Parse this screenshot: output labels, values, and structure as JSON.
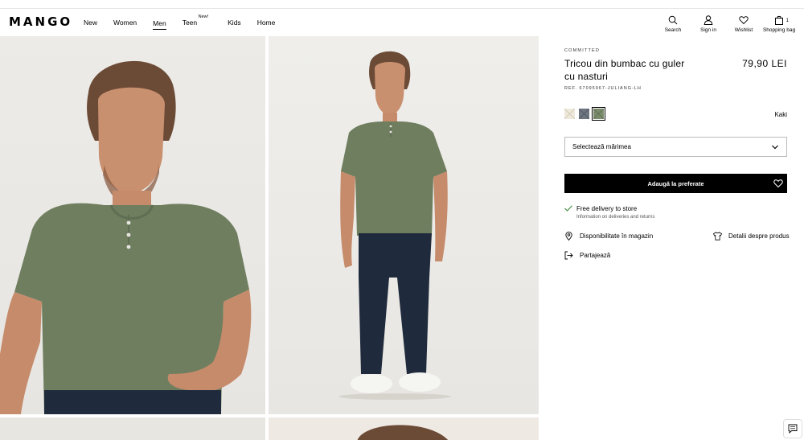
{
  "header": {
    "logo": "MANGO",
    "nav": [
      {
        "label": "New"
      },
      {
        "label": "Women"
      },
      {
        "label": "Men"
      },
      {
        "label": "Teen",
        "badge": "New!"
      },
      {
        "label": "Kids"
      },
      {
        "label": "Home"
      }
    ],
    "tools": {
      "search": "Search",
      "signin": "Sign in",
      "wishlist": "Wishlist",
      "bag": "Shopping bag",
      "bag_count": "1"
    }
  },
  "product": {
    "collection": "COMMITTED",
    "title": "Tricou din bumbac cu guler cu nasturi",
    "price": "79,90 LEI",
    "ref": "REF. 67095967-JULIANG-LH",
    "colors": [
      {
        "name": "light",
        "hex": "#efe9dc"
      },
      {
        "name": "slate",
        "hex": "#6d7680"
      },
      {
        "name": "khaki",
        "hex": "#7a8c6c"
      }
    ],
    "selected_color": "Kaki",
    "size_placeholder": "Selectează mărimea",
    "add_button": "Adaugă la preferate",
    "delivery_title": "Free delivery to store",
    "delivery_sub": "Information on deliveries and returns",
    "availability": "Disponibilitate în magazin",
    "details": "Detalii despre produs",
    "share": "Partajează"
  },
  "colors": {
    "accent": "#000000",
    "check": "#3a8a3a",
    "shirt": "#6f7e5f",
    "jeans": "#1f2a3d"
  }
}
